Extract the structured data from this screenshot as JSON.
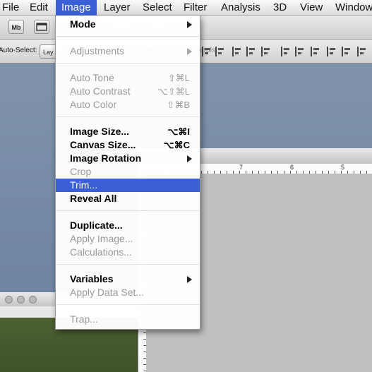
{
  "menubar": {
    "items": [
      "File",
      "Edit",
      "Image",
      "Layer",
      "Select",
      "Filter",
      "Analysis",
      "3D",
      "View",
      "Window"
    ],
    "active_index": 2
  },
  "toolbar": {
    "mb_label": "Mb",
    "auto_select_label": "Auto-Select:",
    "layer_dropdown": "Lay",
    "transform_controls": "Show Transform Controls"
  },
  "ruler": {
    "labels": [
      "7",
      "6",
      "5"
    ]
  },
  "image_menu": {
    "items": [
      {
        "label": "Mode",
        "shortcut": "",
        "submenu": true,
        "enabled": true
      },
      {
        "label": "Adjustments",
        "shortcut": "",
        "submenu": true,
        "enabled": false
      },
      {
        "label": "Auto Tone",
        "shortcut": "⇧⌘L",
        "submenu": false,
        "enabled": false
      },
      {
        "label": "Auto Contrast",
        "shortcut": "⌥⇧⌘L",
        "submenu": false,
        "enabled": false
      },
      {
        "label": "Auto Color",
        "shortcut": "⇧⌘B",
        "submenu": false,
        "enabled": false
      },
      {
        "label": "Image Size...",
        "shortcut": "⌥⌘I",
        "submenu": false,
        "enabled": true
      },
      {
        "label": "Canvas Size...",
        "shortcut": "⌥⌘C",
        "submenu": false,
        "enabled": true
      },
      {
        "label": "Image Rotation",
        "shortcut": "",
        "submenu": true,
        "enabled": true
      },
      {
        "label": "Crop",
        "shortcut": "",
        "submenu": false,
        "enabled": false
      },
      {
        "label": "Trim...",
        "shortcut": "",
        "submenu": false,
        "enabled": true,
        "highlighted": true
      },
      {
        "label": "Reveal All",
        "shortcut": "",
        "submenu": false,
        "enabled": true
      },
      {
        "label": "Duplicate...",
        "shortcut": "",
        "submenu": false,
        "enabled": true
      },
      {
        "label": "Apply Image...",
        "shortcut": "",
        "submenu": false,
        "enabled": false
      },
      {
        "label": "Calculations...",
        "shortcut": "",
        "submenu": false,
        "enabled": false
      },
      {
        "label": "Variables",
        "shortcut": "",
        "submenu": true,
        "enabled": true
      },
      {
        "label": "Apply Data Set...",
        "shortcut": "",
        "submenu": false,
        "enabled": false
      },
      {
        "label": "Trap...",
        "shortcut": "",
        "submenu": false,
        "enabled": false
      }
    ]
  },
  "colors": {
    "highlight": "#3a5fd6",
    "workspace": "#7489a6",
    "disabled_text": "#9a9a9a"
  }
}
